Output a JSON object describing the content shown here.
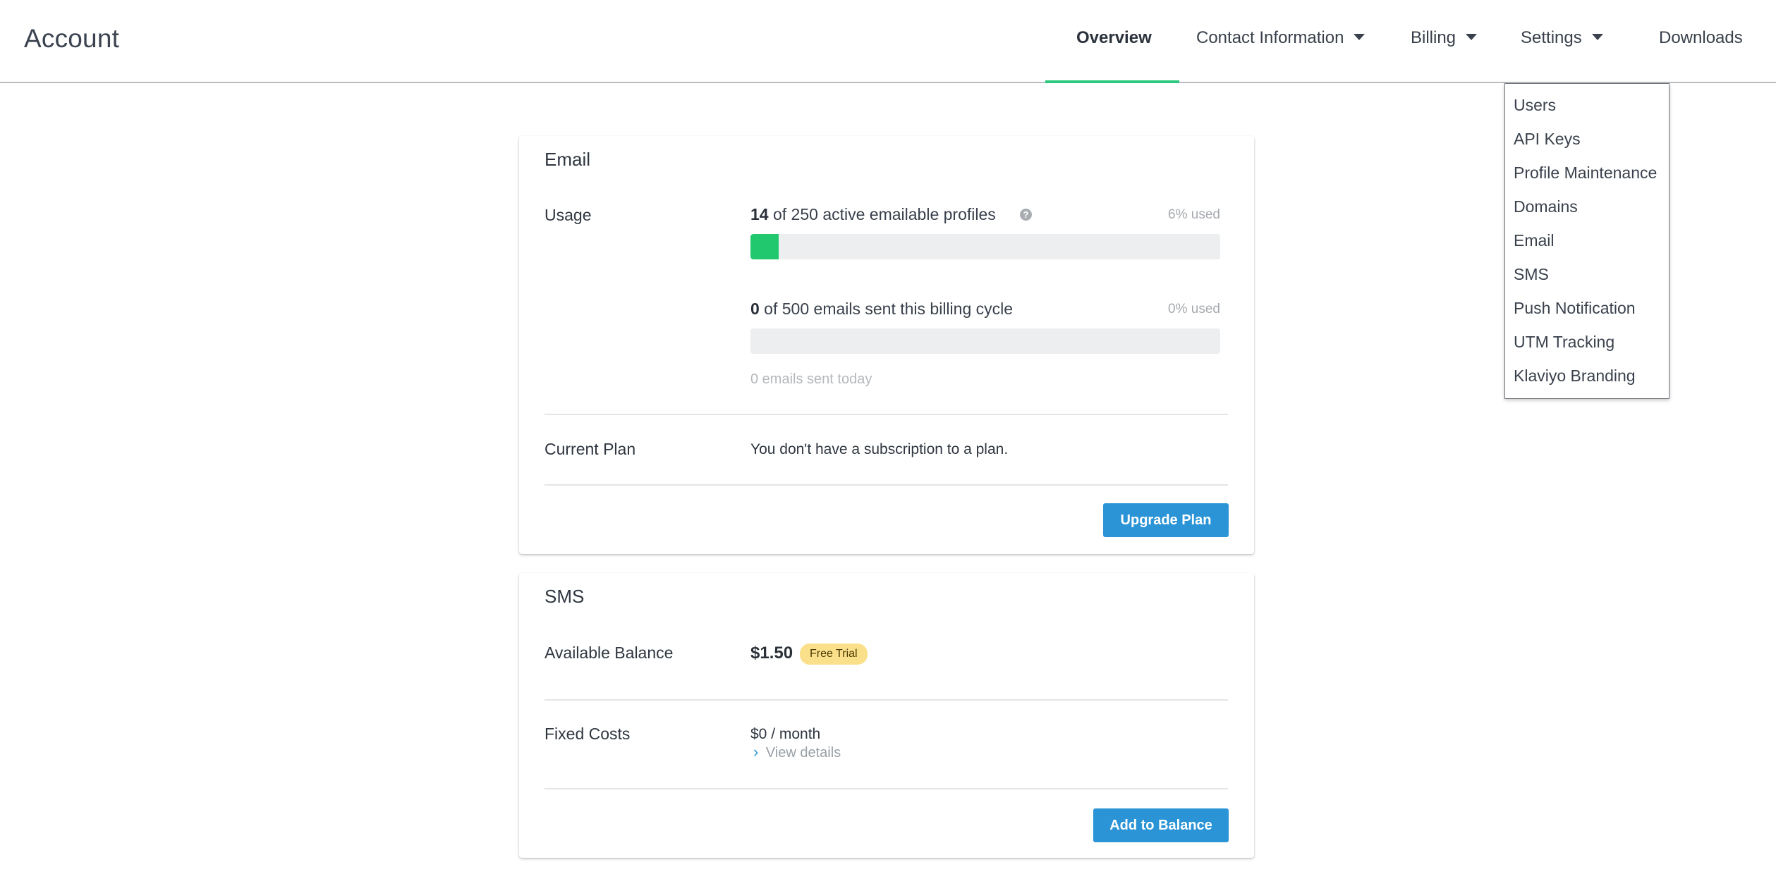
{
  "header": {
    "title": "Account",
    "nav": [
      {
        "label": "Overview",
        "active": true
      },
      {
        "label": "Contact Information",
        "dropdown": true
      },
      {
        "label": "Billing",
        "dropdown": true
      },
      {
        "label": "Settings",
        "dropdown": true
      },
      {
        "label": "Downloads"
      }
    ]
  },
  "settings_menu": {
    "items": [
      "Users",
      "API Keys",
      "Profile Maintenance",
      "Domains",
      "Email",
      "SMS",
      "Push Notification",
      "UTM Tracking",
      "Klaviyo Branding"
    ]
  },
  "email_card": {
    "title": "Email",
    "usage_label": "Usage",
    "profiles": {
      "count": "14",
      "text": " of 250 active emailable profiles",
      "pct_label": "6% used",
      "fraction": 0.06
    },
    "emails": {
      "count": "0",
      "text": " of 500 emails sent this billing cycle",
      "pct_label": "0% used",
      "fraction": 0.0
    },
    "sent_today": "0 emails sent today",
    "plan_label": "Current Plan",
    "plan_text": "You don't have a subscription to a plan.",
    "upgrade_button": "Upgrade Plan"
  },
  "sms_card": {
    "title": "SMS",
    "balance_label": "Available Balance",
    "balance": "$1.50",
    "badge": "Free Trial",
    "fixed_label": "Fixed Costs",
    "fixed_value": "$0 / month",
    "view_details": "View details",
    "add_button": "Add to Balance"
  },
  "colors": {
    "accent": "#2a94d6",
    "progress": "#21c86e",
    "active_tab": "#2dc97e",
    "badge": "#fbe08b"
  },
  "icons": [
    "caret-down-icon",
    "help-icon",
    "chevron-right-icon"
  ]
}
